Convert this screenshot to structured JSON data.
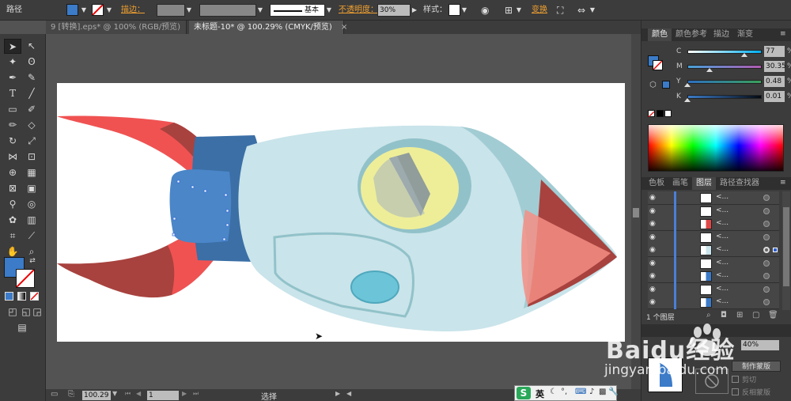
{
  "control_bar": {
    "mode_label": "路径",
    "fill_color": "#3b7bc8",
    "stroke_label": "描边：",
    "stroke_profile": "基本",
    "opacity_label": "不透明度：",
    "opacity_value": "30%",
    "style_label": "样式：",
    "transform_label": "变换"
  },
  "tabs": [
    {
      "label": "9 [转换].eps* @ 100% (RGB/预览)",
      "active": false
    },
    {
      "label": "未标题-10* @ 100.29% (CMYK/预览)",
      "active": true
    }
  ],
  "tab_close_glyph": "×",
  "toolbar": {
    "tools": [
      "selection",
      "direct-selection",
      "magic-wand",
      "lasso",
      "pen",
      "curvature",
      "type",
      "line",
      "rectangle",
      "paintbrush",
      "pencil",
      "eraser",
      "rotate",
      "scale",
      "width",
      "free-transform",
      "shape-builder",
      "perspective",
      "mesh",
      "gradient",
      "eyedropper",
      "blend",
      "symbol-sprayer",
      "column-graph",
      "artboard",
      "slice",
      "hand",
      "zoom"
    ],
    "fill_color": "#3b7bc8"
  },
  "status_bar": {
    "zoom_value": "100.29",
    "artboard_value": "1",
    "tool_label": "选择"
  },
  "color_panel": {
    "tabs": [
      "颜色",
      "颜色参考",
      "描边",
      "渐变"
    ],
    "active_tab": "颜色",
    "sliders": [
      {
        "label": "C",
        "value": "77",
        "unit": "%",
        "fraction": 0.77
      },
      {
        "label": "M",
        "value": "30.35",
        "unit": "%",
        "fraction": 0.3
      },
      {
        "label": "Y",
        "value": "0.48",
        "unit": "%",
        "fraction": 0.005
      },
      {
        "label": "K",
        "value": "0.01",
        "unit": "%",
        "fraction": 0.0
      }
    ]
  },
  "layers_panel": {
    "tabs": [
      "色板",
      "画笔",
      "图层",
      "路径查找器"
    ],
    "active_tab": "图层",
    "layer_name": "<...",
    "row_count": 9,
    "selected_row": 4,
    "footer_label": "1 个图层"
  },
  "transparency_panel": {
    "opacity_value": "40%",
    "make_mask_label": "制作蒙版",
    "clip_label": "剪切",
    "invert_mask_label": "反相蒙版"
  },
  "ime": {
    "logo": "S",
    "lang": "英"
  },
  "watermark": {
    "brand": "Baidu经验",
    "url": "jingyan.baidu.com"
  },
  "colors": {
    "rocket_body": "#c9e4ea",
    "rocket_shade": "#92c2c9",
    "rocket_red": "#f05252",
    "rocket_darkred": "#a8423e",
    "window_yellow": "#eeee99",
    "collar_blue": "#3b6fa6",
    "porthole": "#6cc4d8"
  }
}
